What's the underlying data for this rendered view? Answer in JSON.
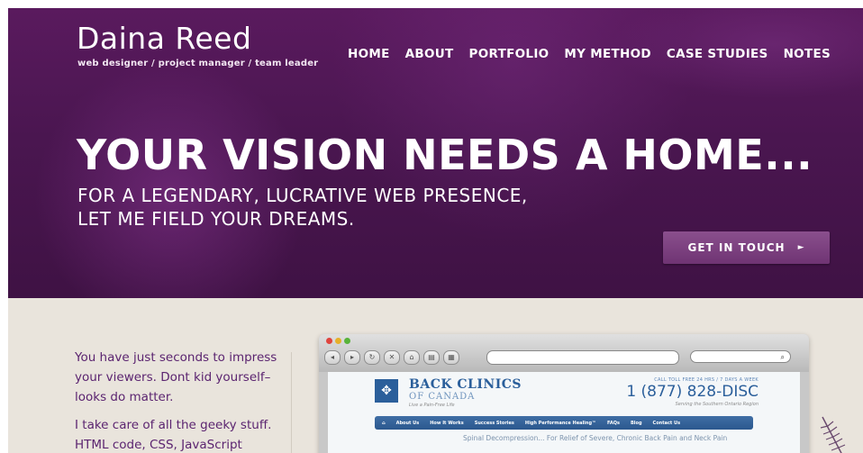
{
  "header": {
    "logo_name": "Daina Reed",
    "logo_tagline": "web designer / project manager / team leader",
    "nav": [
      {
        "label": "HOME"
      },
      {
        "label": "ABOUT"
      },
      {
        "label": "PORTFOLIO"
      },
      {
        "label": "MY METHOD"
      },
      {
        "label": "CASE STUDIES"
      },
      {
        "label": "NOTES"
      }
    ]
  },
  "hero": {
    "headline": "YOUR VISION NEEDS A HOME...",
    "subline_1": "FOR A LEGENDARY, LUCRATIVE WEB PRESENCE,",
    "subline_2": "LET ME FIELD YOUR DREAMS.",
    "cta_label": "GET IN TOUCH",
    "cta_arrow": "►"
  },
  "intro": {
    "paragraph_1": "You have just seconds to impress your viewers. Dont kid yourself– looks do matter.",
    "paragraph_2": "I take care of all the geeky stuff. HTML code, CSS, JavaScript"
  },
  "showcase": {
    "site_title": "BACK CLINICS",
    "site_subtitle": "OF CANADA",
    "site_tagline": "Live a Pain-Free Life",
    "call_line": "CALL TOLL FREE 24 HRS / 7 DAYS A WEEK",
    "phone": "1 (877) 828-DISC",
    "region": "Serving the Southern Ontario Region",
    "nav": [
      "About Us",
      "How It Works",
      "Success Stories",
      "High Performance Healing™",
      "FAQs",
      "Blog",
      "Contact Us"
    ],
    "strapline": "Spinal Decompression... For Relief of Severe, Chronic Back Pain and Neck Pain"
  },
  "colors": {
    "hero_purple": "#4a1650",
    "accent_text": "#5b2470",
    "cta": "#7b3f7f",
    "background": "#e9e4dc"
  }
}
